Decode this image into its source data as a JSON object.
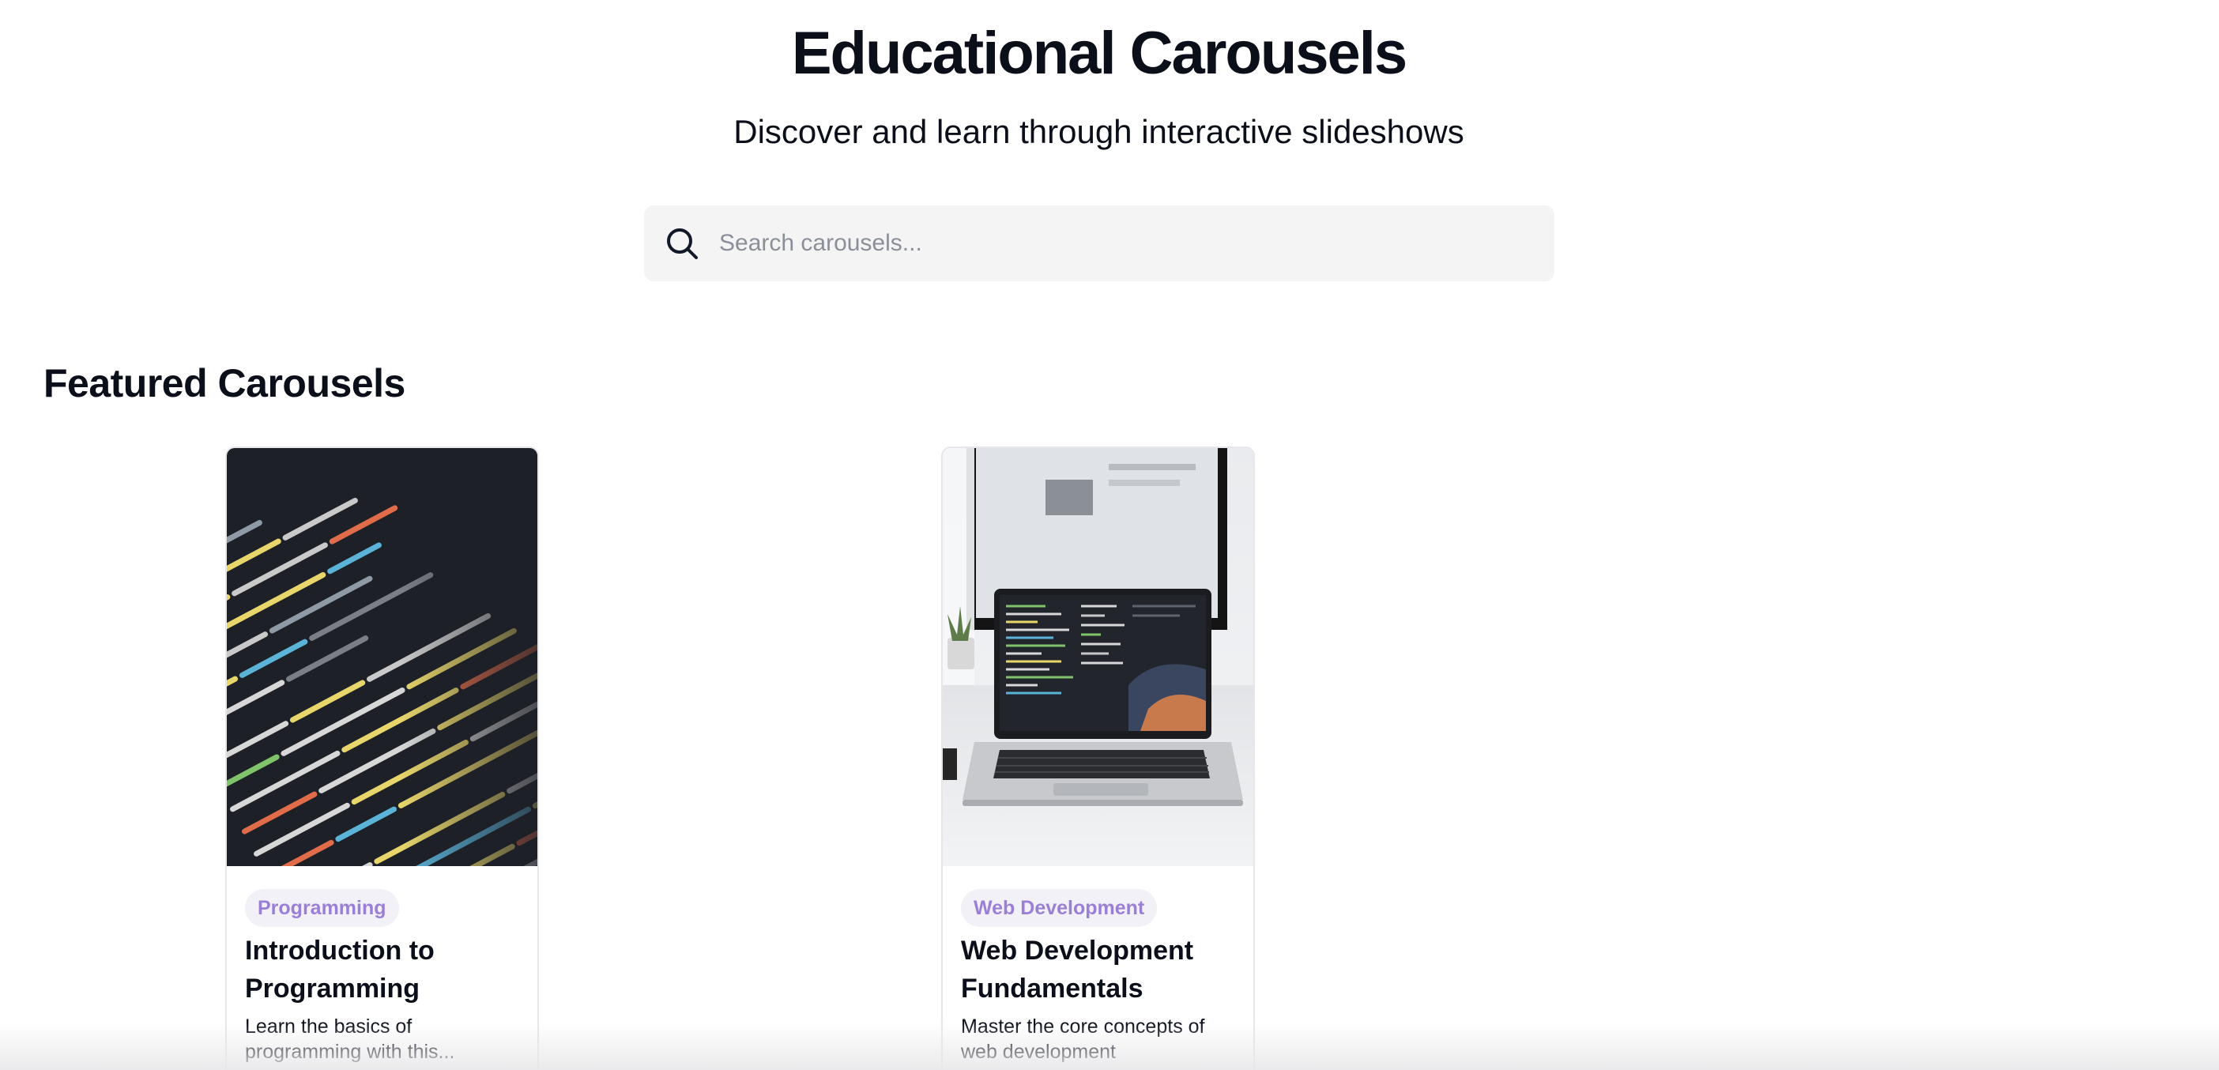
{
  "header": {
    "title": "Educational Carousels",
    "subtitle": "Discover and learn through interactive slideshows"
  },
  "search": {
    "placeholder": "Search carousels...",
    "value": "",
    "icon": "search-icon"
  },
  "featured": {
    "heading": "Featured Carousels",
    "cards": [
      {
        "category": "Programming",
        "title": "Introduction to Programming",
        "description": "Learn the basics of programming with this...",
        "image": "code-screen-image"
      },
      {
        "category": "Web Development",
        "title": "Web Development Fundamentals",
        "description": "Master the core concepts of web development",
        "image": "laptop-desk-image"
      }
    ]
  },
  "colors": {
    "text": "#0b0f1a",
    "search_bg": "#f4f4f5",
    "badge_bg": "#f3f1f8",
    "badge_text": "#9a7fd6",
    "card_border": "#e5e7eb"
  }
}
